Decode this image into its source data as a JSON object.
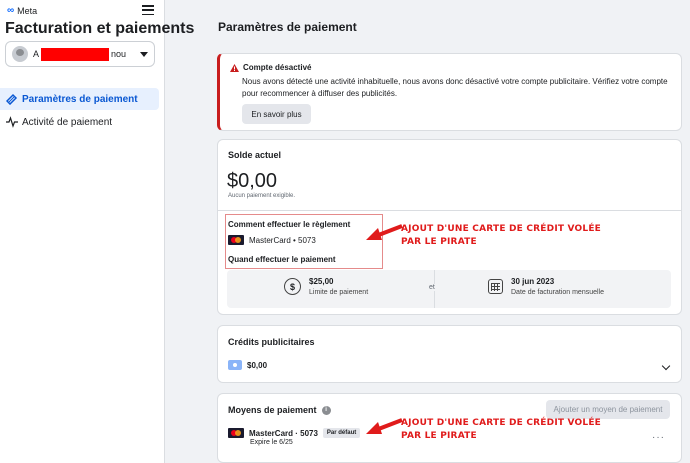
{
  "sidebar": {
    "brand": "Meta",
    "title": "Facturation et paiements",
    "account": {
      "initial": "A",
      "suffix": "nou"
    },
    "nav": [
      {
        "label": "Paramètres de paiement",
        "active": true
      },
      {
        "label": "Activité de paiement",
        "active": false
      }
    ]
  },
  "main": {
    "title": "Paramètres de paiement",
    "warning": {
      "title": "Compte désactivé",
      "text": "Nous avons détecté une activité inhabituelle, nous avons donc désactivé votre compte publicitaire. Vérifiez votre compte pour recommencer à diffuser des publicités.",
      "button": "En savoir plus",
      "accent": "#c81d1d"
    },
    "balance": {
      "title": "Solde actuel",
      "amount": "$0,00",
      "subtitle": "Aucun paiement exigible.",
      "how_label": "Comment effectuer le règlement",
      "card": "MasterCard • 5073",
      "when_label": "Quand effectuer le paiement",
      "limit_value": "$25,00",
      "limit_label": "Limite de paiement",
      "and": "et",
      "billing_date": "30 jun 2023",
      "billing_label": "Date de facturation mensuelle"
    },
    "credits": {
      "title": "Crédits publicitaires",
      "amount": "$0,00"
    },
    "methods": {
      "title": "Moyens de paiement",
      "add_button": "Ajouter un moyen de paiement",
      "card": "MasterCard · 5073",
      "badge": "Par défaut",
      "expiry": "Expire le 6/25"
    }
  },
  "annotations": {
    "note_1_line1": "AJOUT D'UNE CARTE DE CRÉDIT VOLÉE",
    "note_1_line2": "PAR LE PIRATE",
    "note_2_line1": "AJOUT D'UNE CARTE DE CRÉDIT VOLÉE",
    "note_2_line2": "PAR LE PIRATE",
    "color": "#e01b1b"
  }
}
